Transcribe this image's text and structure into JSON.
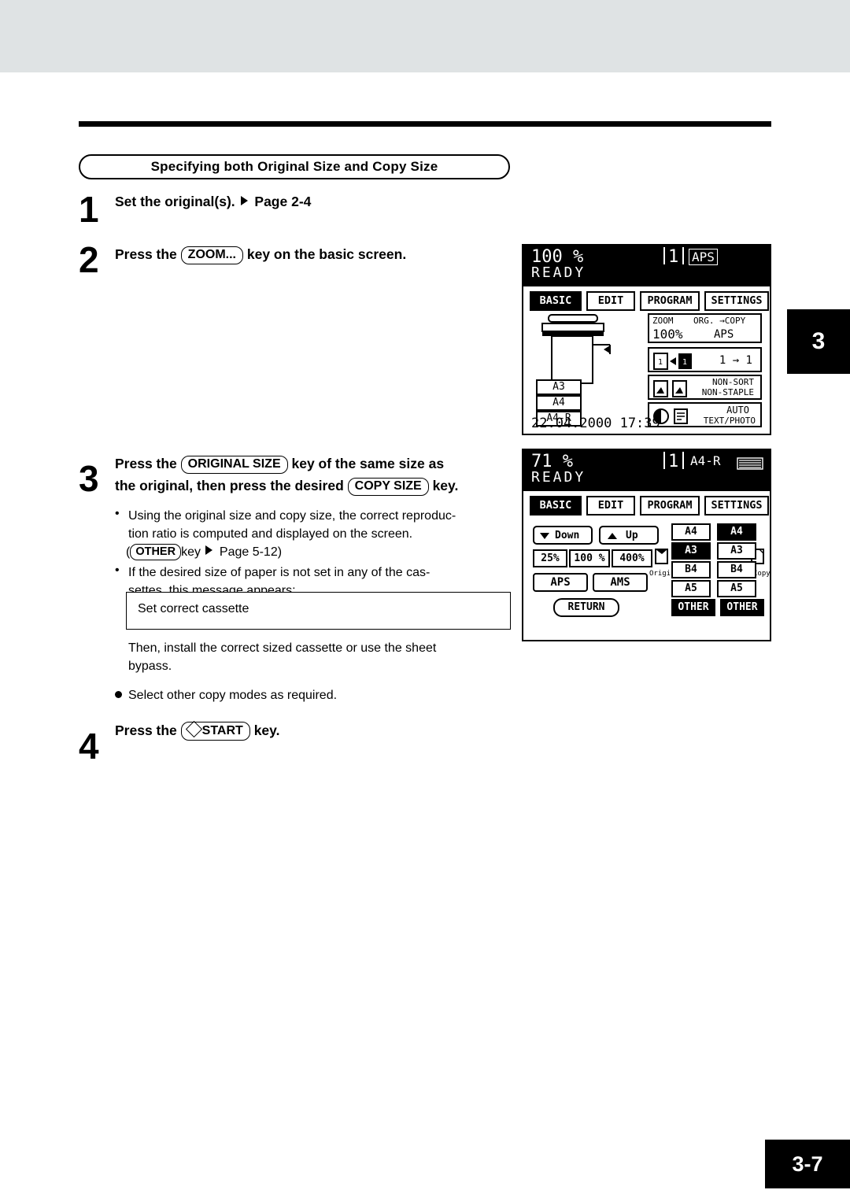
{
  "page": {
    "chapter_tab": "3",
    "footer": "3-7"
  },
  "section": {
    "title": "Specifying both Original Size and Copy Size"
  },
  "steps": [
    {
      "num": "1",
      "text_before": "Set the original(s).",
      "ref": "Page 2-4"
    },
    {
      "num": "2",
      "text_before": "Press the",
      "key": "ZOOM...",
      "text_after": "key on the basic screen."
    },
    {
      "num": "3",
      "line1_before": "Press the",
      "line1_key": "ORIGINAL SIZE",
      "line1_after": "key of the same size as",
      "line2_before": "the original, then press the desired",
      "line2_key": "COPY SIZE",
      "line2_after": "key."
    },
    {
      "num": "4",
      "text_before": "Press the",
      "key": "START",
      "text_after": "key."
    }
  ],
  "notes": {
    "bullet1_line1": "Using the original size and copy size, the correct reproduc-",
    "bullet1_line2": "tion ratio is computed and displayed on the screen.",
    "bullet1_line3_key": "OTHER",
    "bullet1_line3_a": "(",
    "bullet1_line3_b": "key",
    "bullet1_line3_c": "Page 5-12)",
    "bullet2_line1": "If the desired size of paper is not set in any of the cas-",
    "bullet2_line2": "settes, this message appears:",
    "message_box": "Set correct cassette",
    "after_box_line1": "Then, install the correct sized cassette or use the sheet",
    "after_box_line2": "bypass.",
    "disc_bullet": "Select other copy modes as required."
  },
  "lcd_basic": {
    "ratio": "100 %",
    "count": "1",
    "paper_mode": "APS",
    "status": "READY",
    "tabs": [
      {
        "label": "BASIC",
        "selected": true
      },
      {
        "label": "EDIT",
        "selected": false
      },
      {
        "label": "PROGRAM",
        "selected": false
      },
      {
        "label": "SETTINGS",
        "selected": false
      }
    ],
    "zoom_label": "ZOOM",
    "zoom_value": "100%",
    "orgcopy_label": "ORG. →COPY",
    "orgcopy_value": "APS",
    "duplex_value": "1 → 1",
    "finisher_line1": "NON-SORT",
    "finisher_line2": "NON-STAPLE",
    "exposure_line1": "AUTO",
    "exposure_line2": "TEXT/PHOTO",
    "cassettes": [
      "A3",
      "A4",
      "A4-R"
    ],
    "datetime": "22.04.2000 17:39"
  },
  "lcd_size": {
    "ratio": "71 %",
    "count": "1",
    "paper_mode": "A4-R",
    "status": "READY",
    "tabs": [
      {
        "label": "BASIC",
        "selected": true
      },
      {
        "label": "EDIT",
        "selected": false
      },
      {
        "label": "PROGRAM",
        "selected": false
      },
      {
        "label": "SETTINGS",
        "selected": false
      }
    ],
    "down_label": "Down",
    "up_label": "Up",
    "ratio_buttons": [
      "25%",
      "100 %",
      "400%"
    ],
    "original_label": "Original",
    "copy_label": "Copy",
    "original_sizes": [
      "A4",
      "A3",
      "B4",
      "A5",
      "OTHER"
    ],
    "copy_sizes": [
      "A4",
      "A3",
      "B4",
      "A5",
      "OTHER"
    ],
    "aps_label": "APS",
    "ams_label": "AMS",
    "return_label": "RETURN"
  }
}
